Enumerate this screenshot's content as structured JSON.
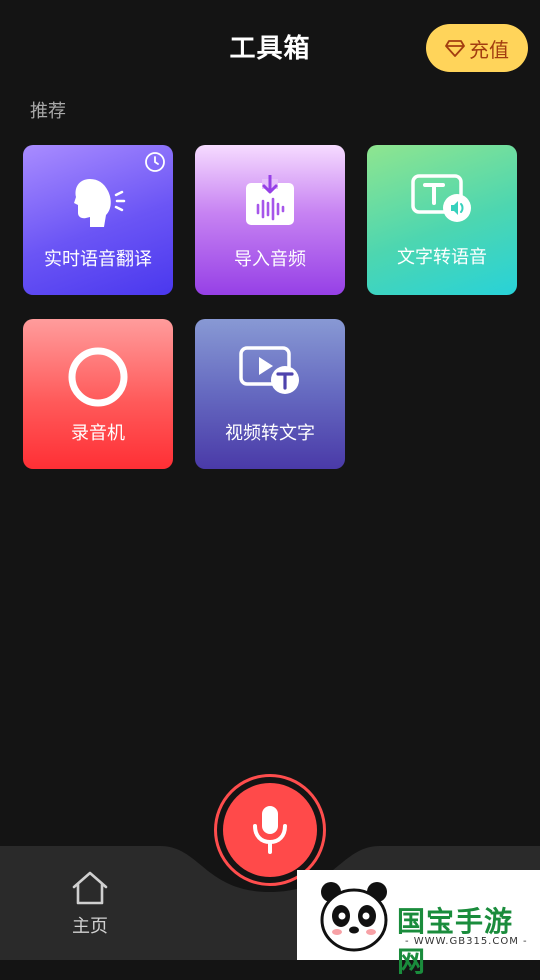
{
  "header": {
    "title": "工具箱",
    "recharge_label": "充值"
  },
  "section": {
    "label": "推荐"
  },
  "tools": [
    {
      "label": "实时语音翻译",
      "icon": "voice-translate-icon"
    },
    {
      "label": "导入音频",
      "icon": "import-audio-icon"
    },
    {
      "label": "文字转语音",
      "icon": "text-to-speech-icon"
    },
    {
      "label": "录音机",
      "icon": "recorder-icon"
    },
    {
      "label": "视频转文字",
      "icon": "video-to-text-icon"
    }
  ],
  "bottom_nav": {
    "home_label": "主页"
  },
  "watermark": {
    "brand": "国宝手游网",
    "url": "- WWW.GB315.COM -"
  },
  "colors": {
    "background": "#141414",
    "recharge_bg": "#ffd45a",
    "mic_red": "#ff4a4a"
  }
}
